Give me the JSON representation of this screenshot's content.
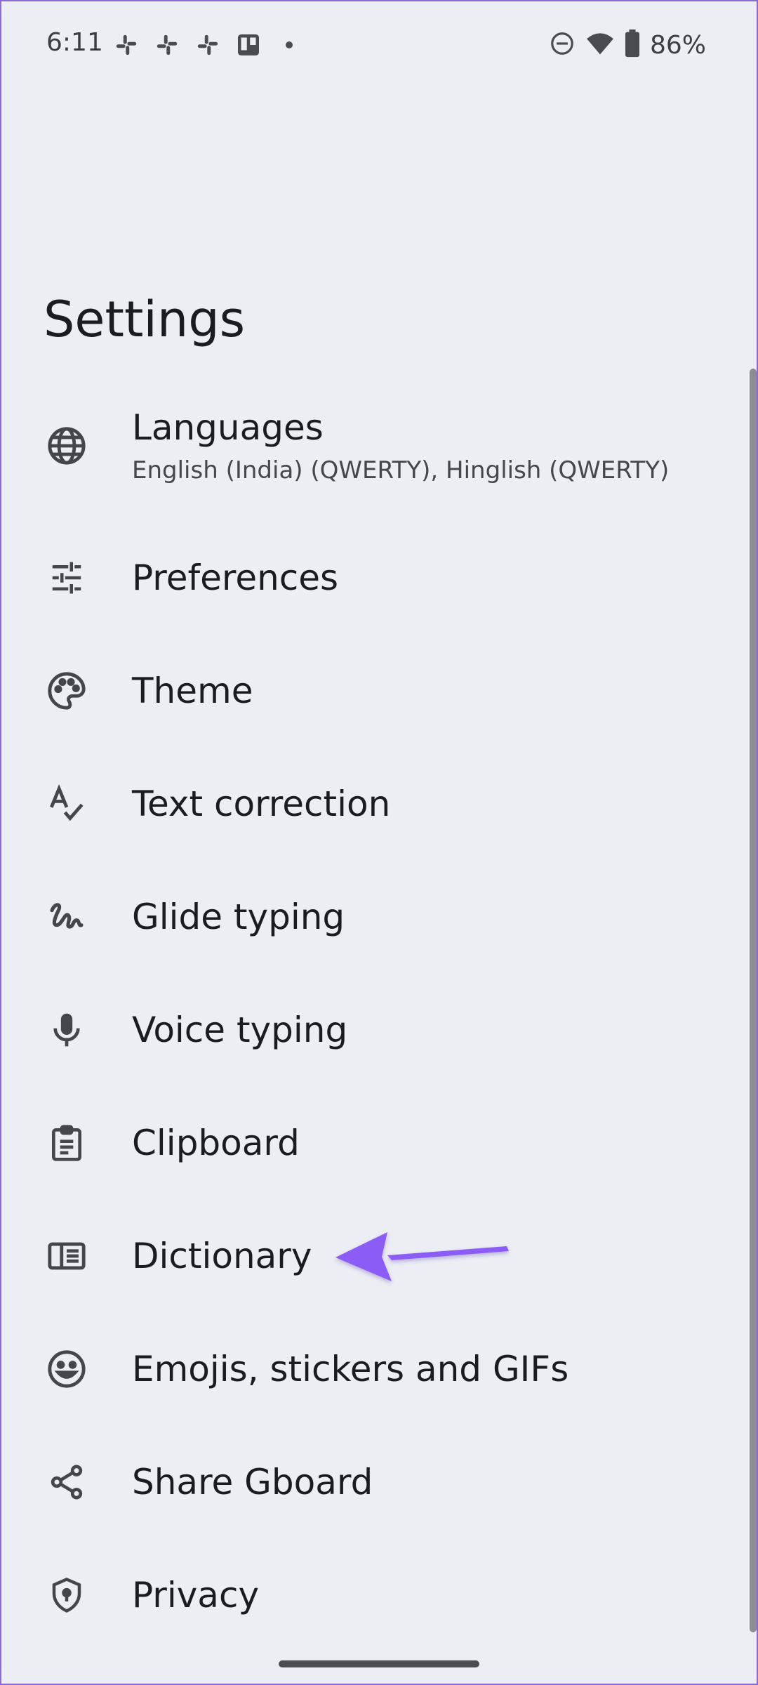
{
  "status_bar": {
    "time": "6:11",
    "battery": "86%",
    "left_icons": [
      "slack-icon",
      "slack-icon",
      "slack-icon",
      "trello-icon",
      "notification-dot-icon"
    ],
    "right_icons": [
      "dnd-icon",
      "wifi-icon",
      "battery-icon"
    ]
  },
  "page": {
    "title": "Settings"
  },
  "settings_items": [
    {
      "title": "Languages",
      "subtitle": "English (India) (QWERTY), Hinglish (QWERTY)",
      "icon": "globe-icon"
    },
    {
      "title": "Preferences",
      "icon": "tune-icon"
    },
    {
      "title": "Theme",
      "icon": "palette-icon"
    },
    {
      "title": "Text correction",
      "icon": "spellcheck-icon"
    },
    {
      "title": "Glide typing",
      "icon": "gesture-icon"
    },
    {
      "title": "Voice typing",
      "icon": "mic-icon"
    },
    {
      "title": "Clipboard",
      "icon": "clipboard-icon"
    },
    {
      "title": "Dictionary",
      "icon": "dictionary-icon"
    },
    {
      "title": "Emojis, stickers and GIFs",
      "icon": "emoji-icon"
    },
    {
      "title": "Share Gboard",
      "icon": "share-icon"
    },
    {
      "title": "Privacy",
      "icon": "shield-icon"
    }
  ],
  "colors": {
    "background": "#ECEEF4",
    "annotation_arrow": "#8B5CF6",
    "icon": "#45464C"
  }
}
